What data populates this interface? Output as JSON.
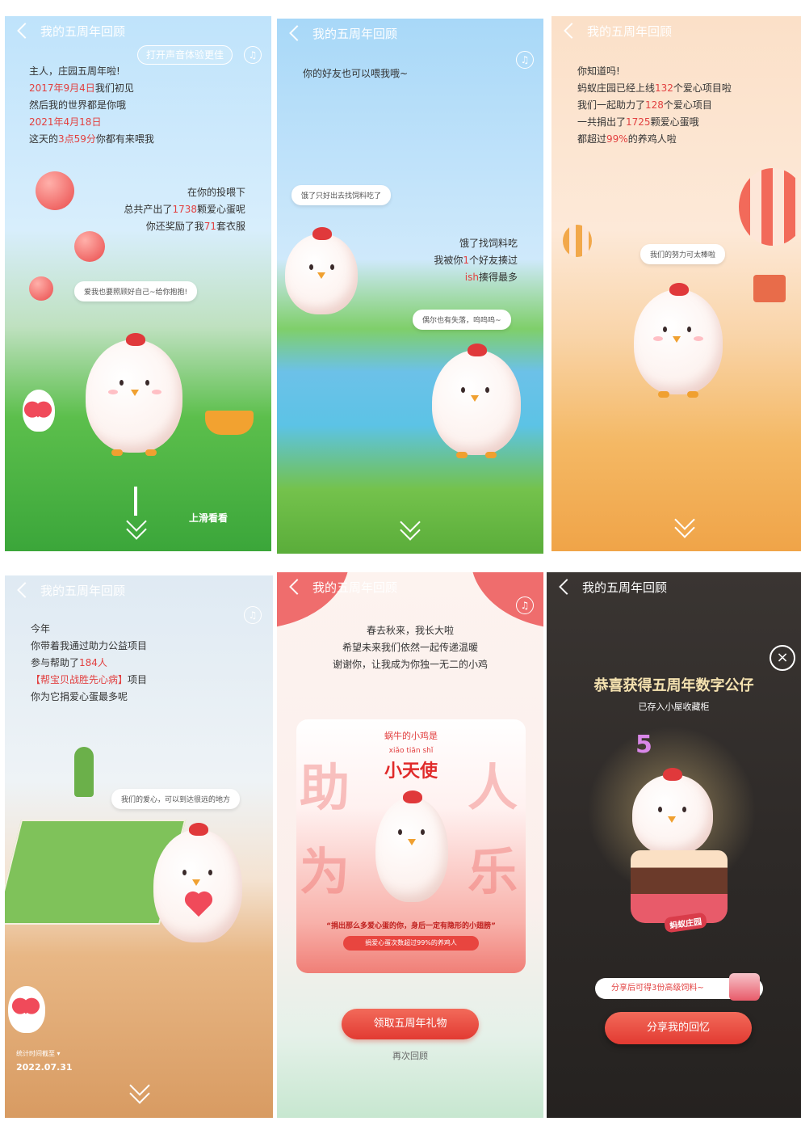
{
  "header_title": "我的五周年回顾",
  "panels": {
    "p1": {
      "sound_tip": "打开声音体验更佳",
      "lines": [
        "主人，庄园五周年啦!",
        "2017年9月4日",
        "我们初见",
        "然后我的世界都是你哦",
        "2021年4月18日",
        "这天的",
        "3点59分",
        "你都有来喂我"
      ],
      "right_lines": [
        "在你的投喂下",
        "总共产出了",
        "1738",
        "颗爱心蛋呢",
        "你还奖励了我",
        "71",
        "套衣服"
      ],
      "bubble": "爱我也要照顾好自己~给你抱抱!",
      "swipe_hint": "上滑看看"
    },
    "p2": {
      "line": "你的好友也可以喂我哦~",
      "bubble_top": "饿了只好出去找饲料吃了",
      "right_lines": [
        "饿了找饲料吃",
        "我被你",
        "1",
        "个好友揍过",
        "ish",
        "揍得最多"
      ],
      "bubble_bottom": "偶尔也有失落，呜呜呜~"
    },
    "p3": {
      "lines": [
        "你知道吗!",
        "蚂蚁庄园已经上线",
        "132",
        "个爱心项目啦",
        "我们一起助力了",
        "128",
        "个爱心项目",
        "一共捐出了",
        "1725",
        "颗爱心蛋哦",
        "都超过",
        "99%",
        "的养鸡人啦"
      ],
      "bubble": "我们的努力可太棒啦"
    },
    "p4": {
      "lines": [
        "今年",
        "你带着我通过助力公益项目",
        "参与帮助了",
        "184人",
        "【帮宝贝战胜先心病】",
        "项目",
        "你为它捐爱心蛋最多呢"
      ],
      "bubble": "我们的爱心，可以到达很远的地方",
      "stat_label": "统计时间截至 ▾",
      "stat_date": "2022.07.31"
    },
    "p5": {
      "lines": [
        "春去秋来，我长大啦",
        "希望未来我们依然一起传递温暖",
        "谢谢你，让我成为你独一无二的小鸡"
      ],
      "card_sub": "蜗牛的小鸡是",
      "pinyin": "xiǎo  tiān  shǐ",
      "card_title": "小天使",
      "bg_chars": [
        "助",
        "人",
        "为",
        "乐"
      ],
      "quote": "“捐出那么多爱心蛋的你，身后一定有隐形的小翅膀”",
      "stat": "捐爱心蛋次数超过99%的养鸡人",
      "main_button": "领取五周年礼物",
      "again_link": "再次回顾"
    },
    "p6": {
      "congrats": "恭喜获得五周年数字公仔",
      "saved": "已存入小屋收藏柜",
      "close_icon": "close-icon",
      "cake_label": "蚂蚁庄园",
      "five": "5",
      "share_tip": "分享后可得3份高级饲料~",
      "share_button": "分享我的回忆"
    }
  },
  "colors": {
    "red": "#e24040",
    "button": "#e8453f",
    "gold": "#f5e2b0"
  }
}
